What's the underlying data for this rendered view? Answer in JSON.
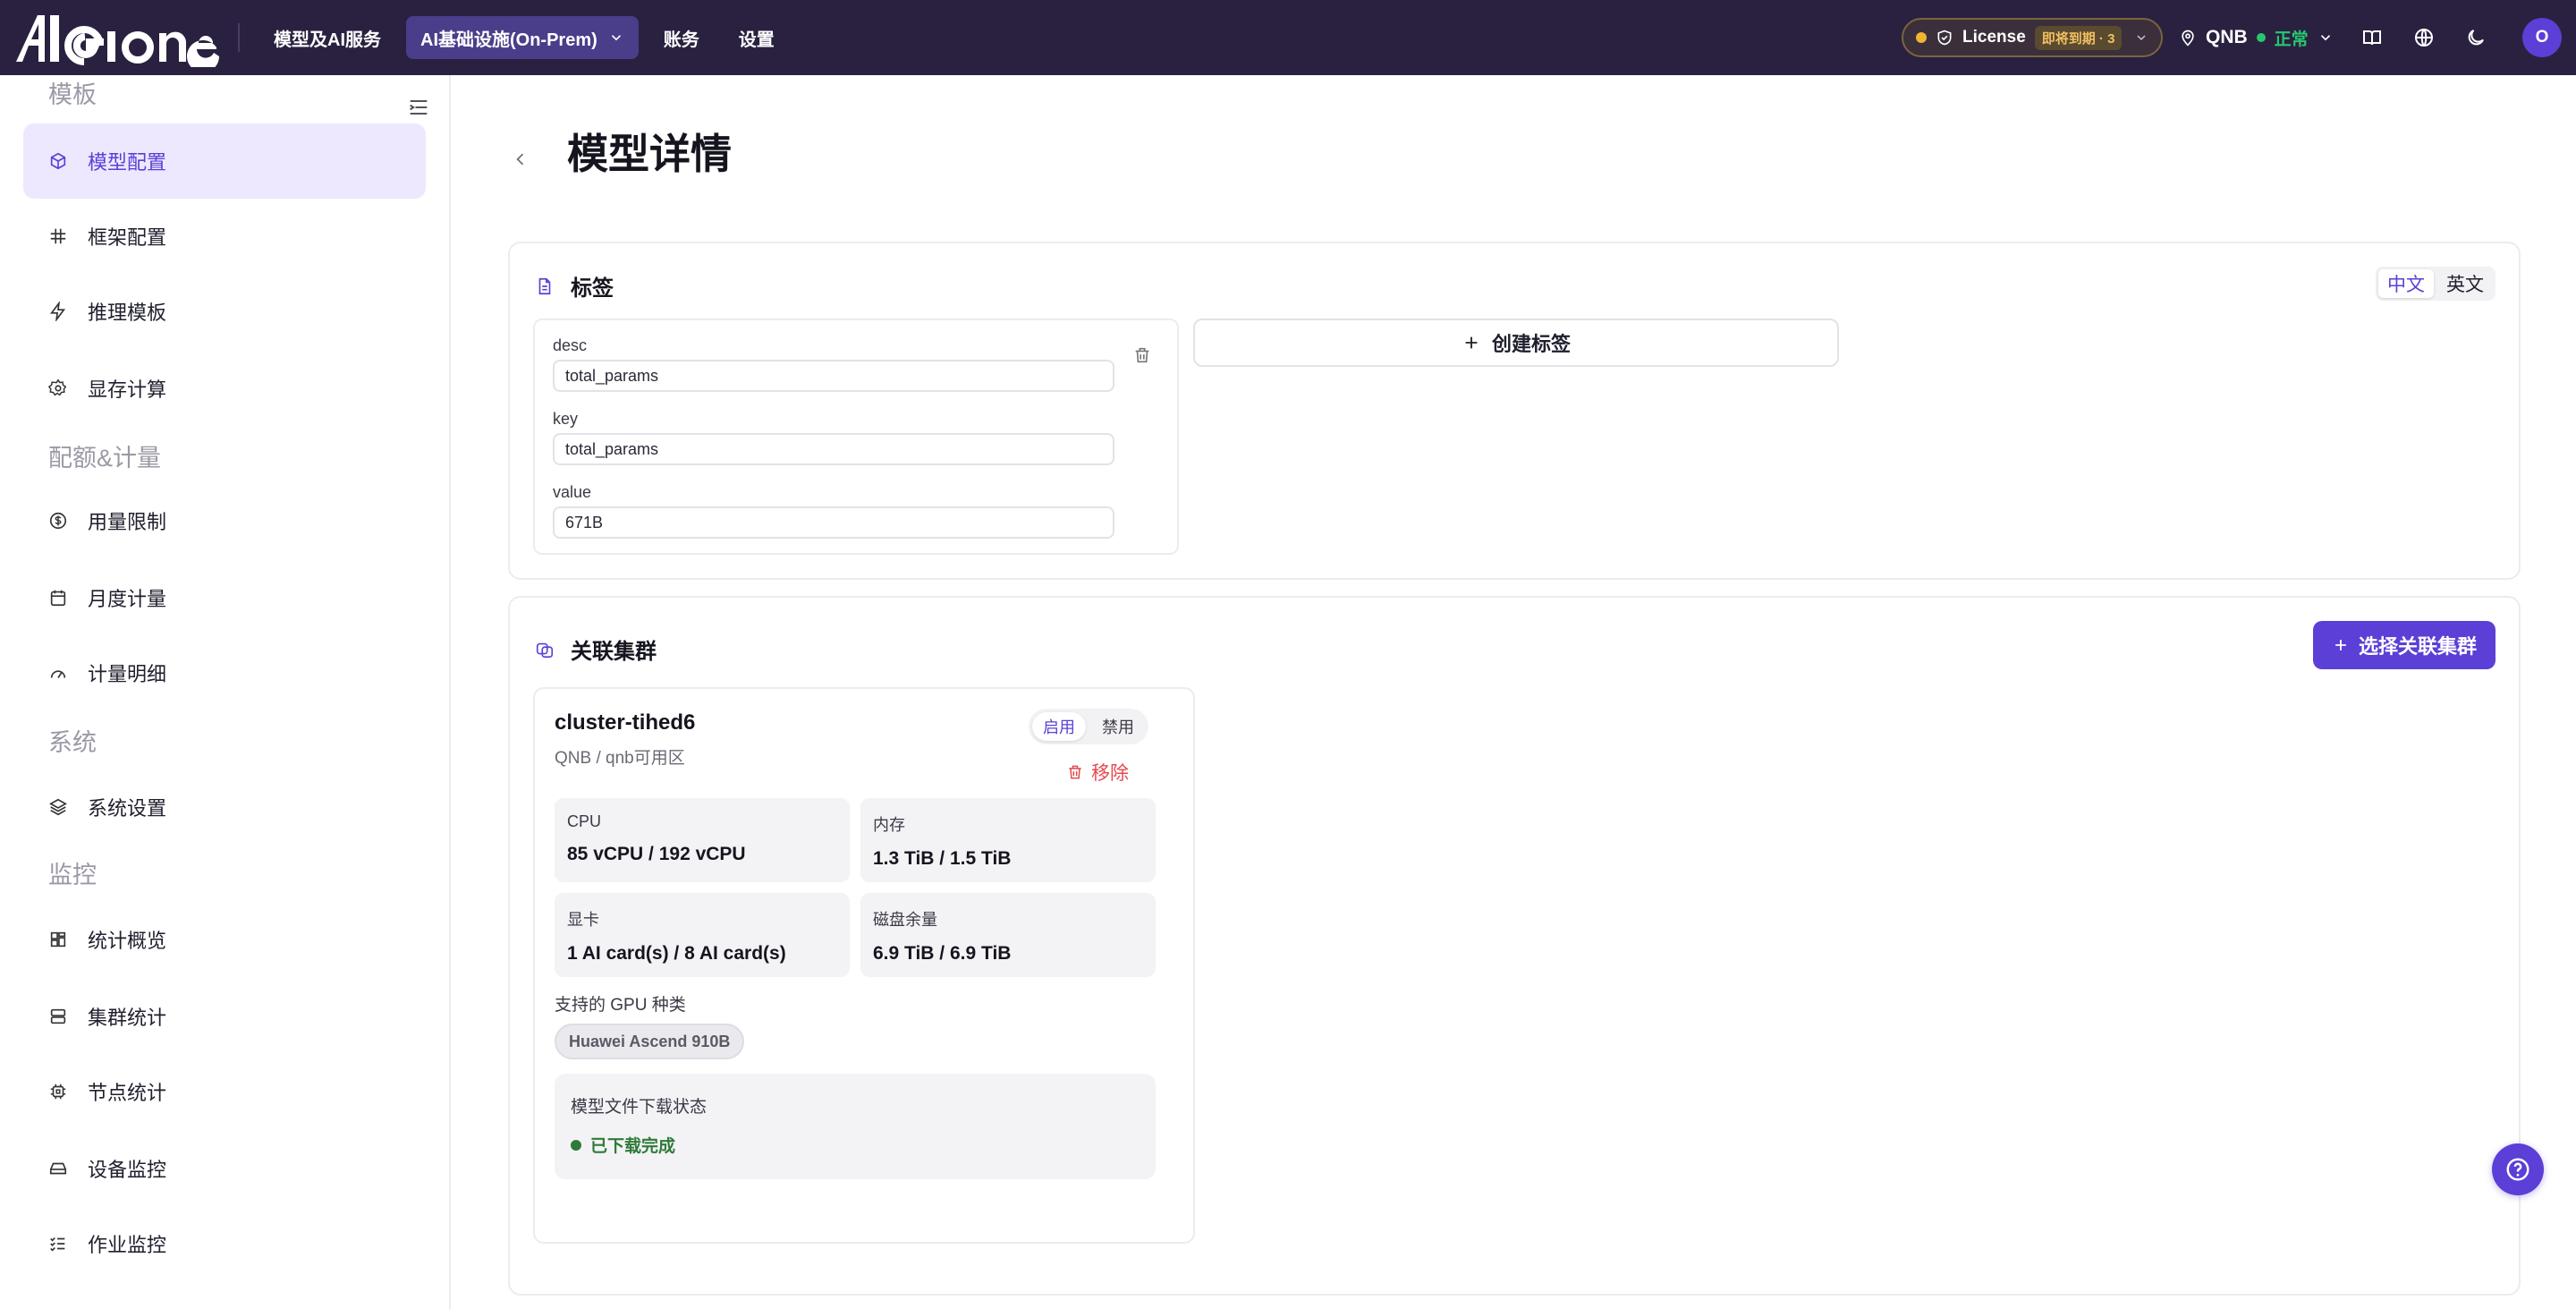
{
  "brand": {
    "logo_text": "AIGIONE"
  },
  "topnav": {
    "items": [
      {
        "label": "模型及AI服务"
      },
      {
        "label": "AI基础设施(On-Prem)"
      },
      {
        "label": "账务"
      },
      {
        "label": "设置"
      }
    ],
    "active_index": 1
  },
  "license": {
    "label": "License",
    "badge": "即将到期 · 3"
  },
  "location": {
    "name": "QNB",
    "status": "正常"
  },
  "user": {
    "avatar_letter": "O"
  },
  "sidebar": {
    "sections": [
      {
        "title": "模板",
        "items": [
          {
            "label": "模型配置",
            "icon": "cube-icon"
          },
          {
            "label": "框架配置",
            "icon": "hash-icon"
          },
          {
            "label": "推理模板",
            "icon": "bolt-icon"
          },
          {
            "label": "显存计算",
            "icon": "gear-icon"
          }
        ]
      },
      {
        "title": "配额&计量",
        "items": [
          {
            "label": "用量限制",
            "icon": "dollar-icon"
          },
          {
            "label": "月度计量",
            "icon": "calendar-icon"
          },
          {
            "label": "计量明细",
            "icon": "gauge-icon"
          }
        ]
      },
      {
        "title": "系统",
        "items": [
          {
            "label": "系统设置",
            "icon": "layers-icon"
          }
        ]
      },
      {
        "title": "监控",
        "items": [
          {
            "label": "统计概览",
            "icon": "dashboard-icon"
          },
          {
            "label": "集群统计",
            "icon": "server-icon"
          },
          {
            "label": "节点统计",
            "icon": "chip-icon"
          },
          {
            "label": "设备监控",
            "icon": "drive-icon"
          },
          {
            "label": "作业监控",
            "icon": "list-check-icon"
          }
        ]
      }
    ]
  },
  "page": {
    "title": "模型详情"
  },
  "tags_card": {
    "title": "标签",
    "lang_options": [
      "中文",
      "英文"
    ],
    "active_lang": 0,
    "tag": {
      "desc_label": "desc",
      "desc_value": "total_params",
      "key_label": "key",
      "key_value": "total_params",
      "value_label": "value",
      "value_value": "671B"
    },
    "create_label": "创建标签"
  },
  "clusters_card": {
    "title": "关联集群",
    "select_label": "选择关联集群",
    "cluster": {
      "name": "cluster-tihed6",
      "location": "QNB / qnb可用区",
      "toggle": [
        "启用",
        "禁用"
      ],
      "toggle_active": 0,
      "remove_label": "移除",
      "stats": [
        {
          "label": "CPU",
          "value": "85 vCPU / 192 vCPU"
        },
        {
          "label": "内存",
          "value": "1.3 TiB / 1.5 TiB"
        },
        {
          "label": "显卡",
          "value": "1 AI card(s) / 8 AI card(s)"
        },
        {
          "label": "磁盘余量",
          "value": "6.9 TiB / 6.9 TiB"
        }
      ],
      "gpu_types_label": "支持的 GPU 种类",
      "gpu_types": [
        "Huawei Ascend 910B"
      ],
      "download_label": "模型文件下载状态",
      "download_status": "已下载完成"
    }
  },
  "colors": {
    "accent": "#5b3fd6",
    "topbar": "#2a2140",
    "success": "#2f7a3a",
    "danger": "#e5484d"
  }
}
